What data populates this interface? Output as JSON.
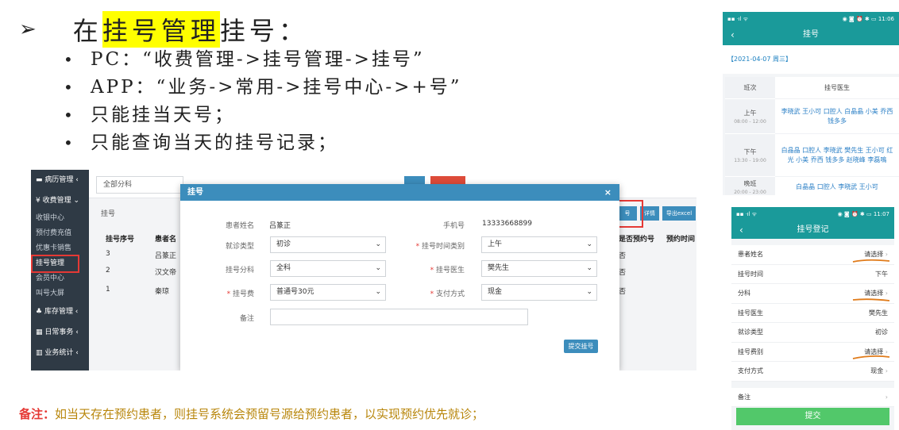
{
  "slide": {
    "heading_prefix": "在",
    "heading_highlight": "挂号管理",
    "heading_suffix": "挂号：",
    "bullets": [
      "PC：“收费管理->挂号管理->挂号”",
      "APP：“业务->常用->挂号中心->+号”",
      "只能挂当天号；",
      "只能查询当天的挂号记录；"
    ],
    "note_label": "备注：",
    "note_text": "如当天存在预约患者，则挂号系统会预留号源给预约患者，以实现预约优先就诊；"
  },
  "desktop": {
    "sidebar": {
      "groups": [
        "病历管理 ‹",
        "¥ 收费管理 ⌄",
        "库存管理 ‹",
        "日常事务 ‹",
        "业务统计 ‹"
      ],
      "sub_items": [
        "收银中心",
        "预付费充值",
        "优惠卡销售",
        "挂号管理",
        "会员中心",
        "叫号大屏"
      ],
      "active": "挂号管理"
    },
    "filter_dept": "全部分科",
    "list_label": "挂号",
    "columns": [
      "挂号序号",
      "患者名",
      "是否预约号",
      "预约时间"
    ],
    "rows": [
      {
        "no": "3",
        "name": "吕篆正",
        "appt": "否"
      },
      {
        "no": "2",
        "name": "汉文帝",
        "appt": "否"
      },
      {
        "no": "1",
        "name": "秦琼",
        "appt": "否"
      }
    ],
    "right_buttons": [
      "号",
      "详情",
      "导出excel"
    ],
    "modal": {
      "title": "挂号",
      "close": "×",
      "patient_label": "患者姓名",
      "patient_value": "吕篆正",
      "phone_label": "手机号",
      "phone_value": "13333668899",
      "visit_type_label": "就诊类型",
      "visit_type_value": "初诊",
      "time_type_label": "挂号时间类别",
      "time_type_value": "上午",
      "dept_label": "挂号分科",
      "dept_value": "全科",
      "doctor_label": "挂号医生",
      "doctor_value": "樊先生",
      "fee_label": "挂号费",
      "fee_value": "普通号30元",
      "pay_label": "支付方式",
      "pay_value": "现金",
      "remark_label": "备注",
      "submit": "提交挂号"
    }
  },
  "phone1": {
    "status_left": "▪▪ ᐧıl ᯤ",
    "status_right": "◉ ◙ ⏰ ✱ ▭ 11:06",
    "title": "挂号",
    "date": "【2021-04-07 周三】",
    "col1": "班次",
    "col2": "挂号医生",
    "shifts": [
      {
        "name": "上午",
        "time": "08:00 - 12:00",
        "doctors": "李晓武 王小可 口腔人 白晶晶 小美 乔西 钱多多"
      },
      {
        "name": "下午",
        "time": "13:30 - 19:00",
        "doctors": "白晶晶 口腔人 李晓武 樊先生 王小可 红光 小美 乔西 钱多多 赵晓峰 李磊鳴"
      },
      {
        "name": "晚班",
        "time": "20:00 - 23:00",
        "doctors": "白晶晶 口腔人 李晓武 王小可"
      }
    ]
  },
  "phone2": {
    "status_left": "▪▪ ᐧıl ᯤ",
    "status_right": "◉ ◙ ⏰ ✱ ▭ 11:07",
    "title": "挂号登记",
    "fields": [
      {
        "label": "患者姓名",
        "value": "请选择"
      },
      {
        "label": "挂号时间",
        "value": "下午"
      },
      {
        "label": "分科",
        "value": "请选择"
      },
      {
        "label": "挂号医生",
        "value": "樊先生"
      },
      {
        "label": "就诊类型",
        "value": "初诊"
      },
      {
        "label": "挂号费别",
        "value": "请选择"
      },
      {
        "label": "支付方式",
        "value": "现金"
      }
    ],
    "remark": "备注",
    "submit": "提交",
    "annotation_color": "#e07b1a"
  }
}
